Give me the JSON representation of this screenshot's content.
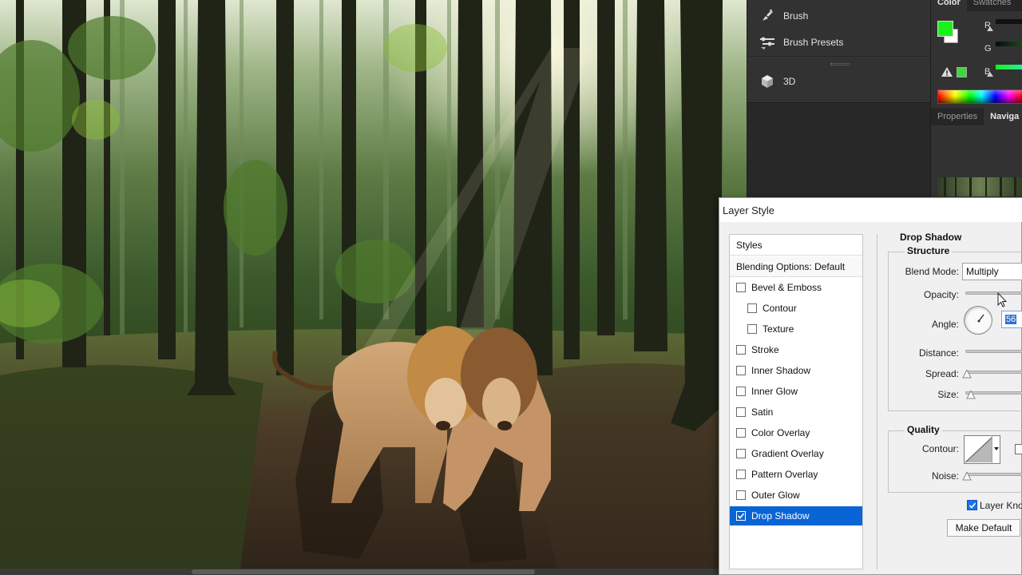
{
  "panels_column": {
    "items": [
      {
        "label": "Brush",
        "icon": "brush-icon"
      },
      {
        "label": "Brush Presets",
        "icon": "brush-presets-icon"
      },
      {
        "label": "3D",
        "icon": "3d-cube-icon"
      }
    ]
  },
  "color_panel": {
    "tabs": [
      "Color",
      "Swatches"
    ],
    "foreground_color": "#1cf01c",
    "background_color": "#ffffff",
    "channels": [
      "R",
      "G",
      "B"
    ]
  },
  "navigator_panel": {
    "tabs": [
      "Properties",
      "Navigator"
    ],
    "visible_tab_labels": [
      "Properties",
      "Naviga"
    ]
  },
  "dialog": {
    "title": "Layer Style",
    "styles_header": "Styles",
    "blending_options": "Blending Options: Default",
    "styles": [
      {
        "label": "Bevel & Emboss",
        "checked": false,
        "indent": 0
      },
      {
        "label": "Contour",
        "checked": false,
        "indent": 1
      },
      {
        "label": "Texture",
        "checked": false,
        "indent": 1
      },
      {
        "label": "Stroke",
        "checked": false,
        "indent": 0
      },
      {
        "label": "Inner Shadow",
        "checked": false,
        "indent": 0
      },
      {
        "label": "Inner Glow",
        "checked": false,
        "indent": 0
      },
      {
        "label": "Satin",
        "checked": false,
        "indent": 0
      },
      {
        "label": "Color Overlay",
        "checked": false,
        "indent": 0
      },
      {
        "label": "Gradient Overlay",
        "checked": false,
        "indent": 0
      },
      {
        "label": "Pattern Overlay",
        "checked": false,
        "indent": 0
      },
      {
        "label": "Outer Glow",
        "checked": false,
        "indent": 0
      },
      {
        "label": "Drop Shadow",
        "checked": true,
        "indent": 0,
        "selected": true
      }
    ],
    "section_title": "Drop Shadow",
    "structure": {
      "title": "Structure",
      "blend_mode_label": "Blend Mode:",
      "blend_mode_value": "Multiply",
      "opacity_label": "Opacity:",
      "angle_label": "Angle:",
      "angle_value": "56",
      "distance_label": "Distance:",
      "spread_label": "Spread:",
      "size_label": "Size:"
    },
    "quality": {
      "title": "Quality",
      "contour_label": "Contour:",
      "noise_label": "Noise:"
    },
    "layer_knocks_out_label": "Layer Kno",
    "make_default_label": "Make Default"
  }
}
